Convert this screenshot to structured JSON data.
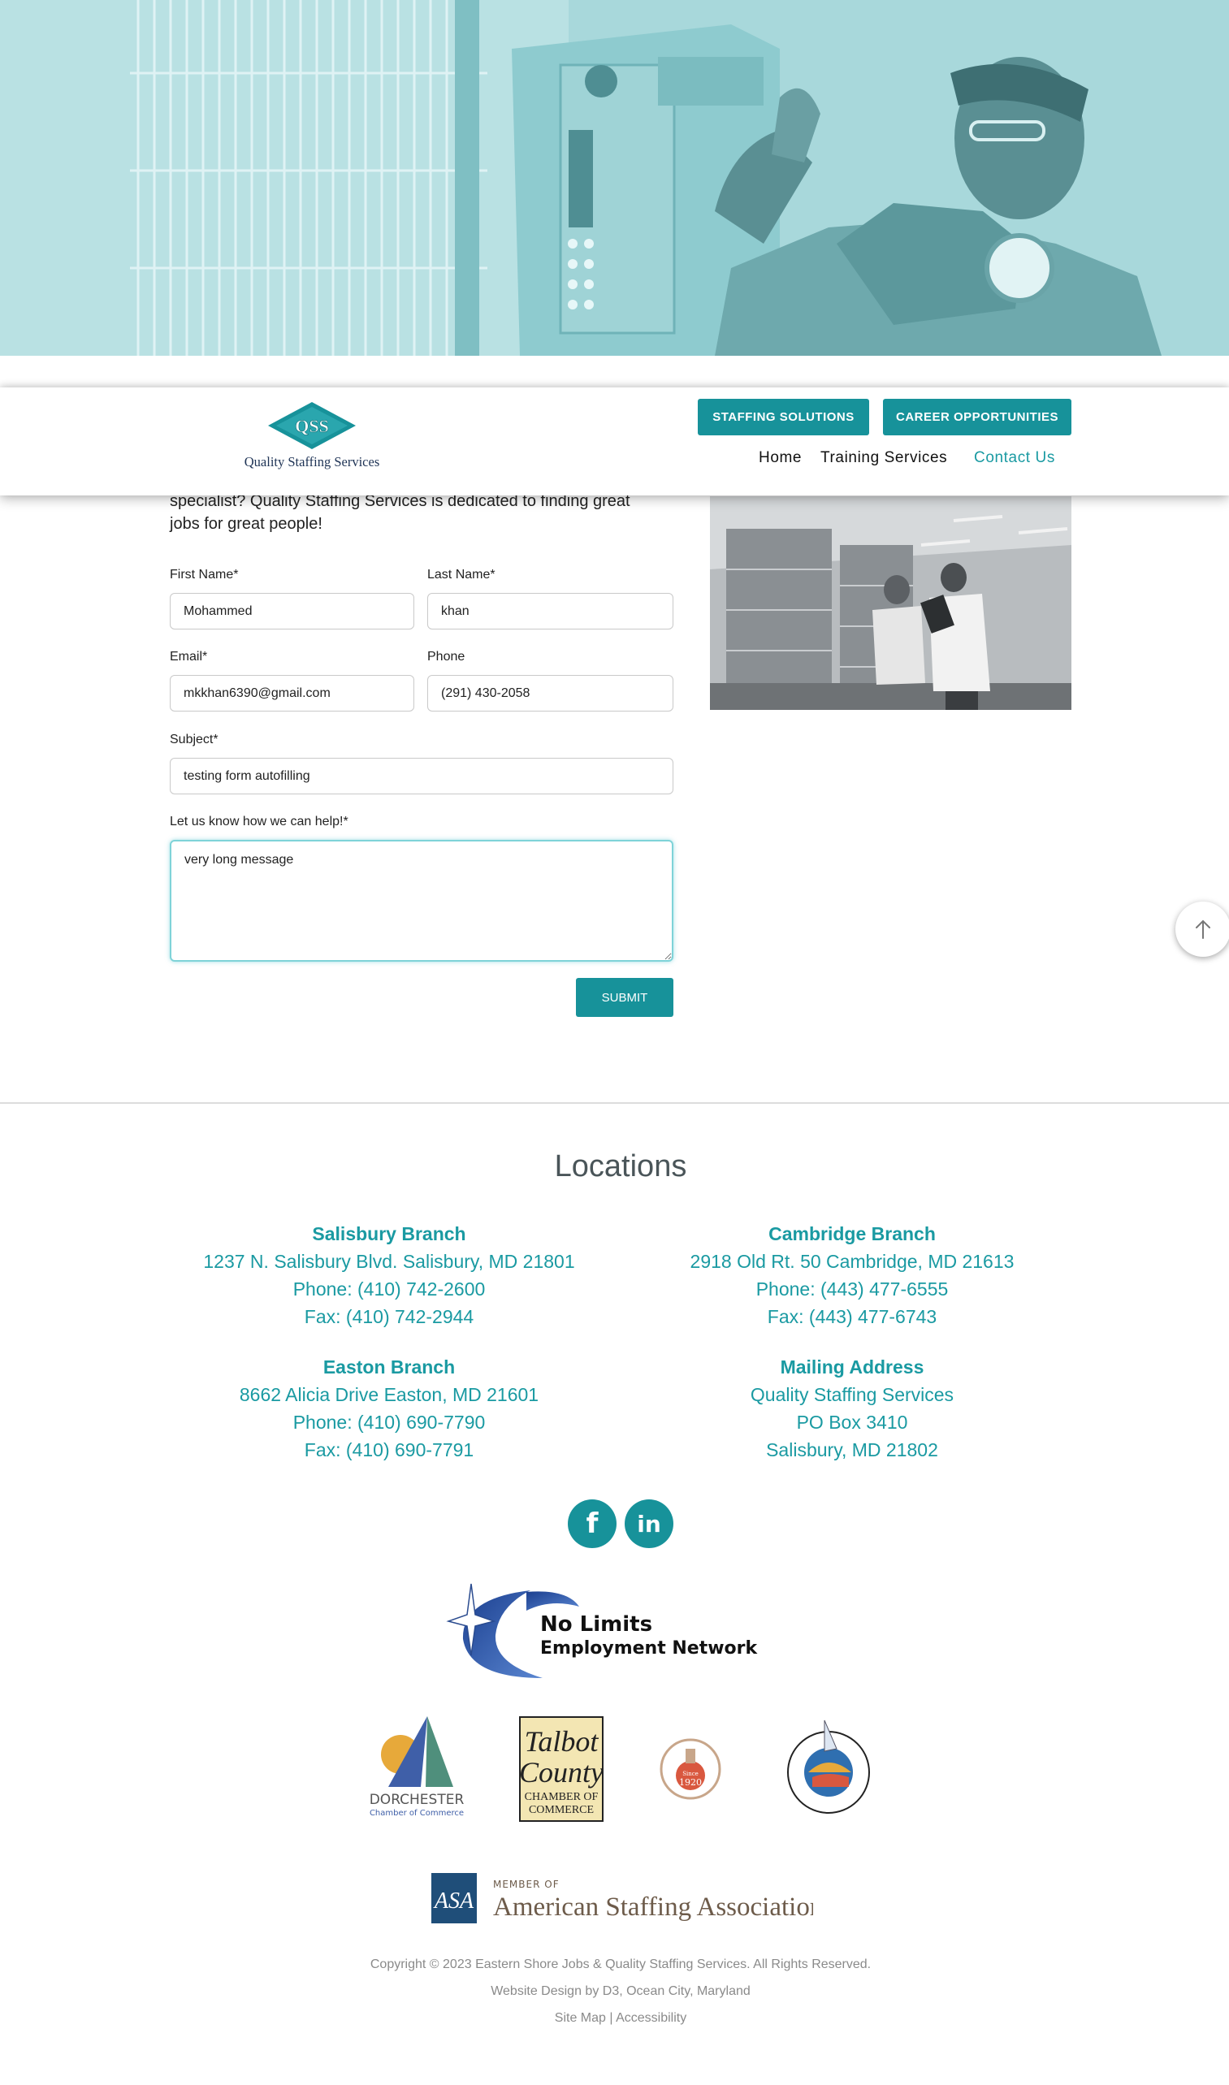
{
  "header": {
    "logo_text": "Quality Staffing Services",
    "logo_mark": "QSS",
    "buttons": {
      "staffing": "STAFFING SOLUTIONS",
      "career": "CAREER OPPORTUNITIES"
    },
    "nav": {
      "home": "Home",
      "training": "Training Services",
      "contact": "Contact Us"
    }
  },
  "form": {
    "intro_line1": "specialist? Quality Staffing Services is dedicated to finding great",
    "intro_line2": "jobs for great people!",
    "first_name": {
      "label": "First Name*",
      "value": "Mohammed"
    },
    "last_name": {
      "label": "Last Name*",
      "value": "khan"
    },
    "email": {
      "label": "Email*",
      "value": "mkkhan6390@gmail.com"
    },
    "phone": {
      "label": "Phone",
      "value": "(291) 430-2058"
    },
    "subject": {
      "label": "Subject*",
      "value": "testing form autofilling"
    },
    "message": {
      "label": "Let us know how we can help!*",
      "value": "very long message"
    },
    "submit_label": "SUBMIT"
  },
  "locations": {
    "title": "Locations",
    "branches": [
      {
        "name": "Salisbury Branch",
        "address": "1237 N. Salisbury Blvd. Salisbury, MD 21801",
        "phone": "Phone: (410) 742-2600",
        "fax": "Fax: (410) 742-2944"
      },
      {
        "name": "Cambridge Branch",
        "address": "2918 Old Rt. 50 Cambridge, MD 21613",
        "phone": "Phone: (443) 477-6555",
        "fax": "Fax: (443) 477-6743"
      },
      {
        "name": "Easton Branch",
        "address": "8662 Alicia Drive Easton, MD 21601",
        "phone": "Phone: (410) 690-7790",
        "fax": "Fax: (410) 690-7791"
      },
      {
        "name": "Mailing Address",
        "address": "Quality Staffing Services",
        "phone": "PO Box 3410",
        "fax": "Salisbury, MD 21802"
      }
    ]
  },
  "social": {
    "facebook": "f",
    "linkedin": "in"
  },
  "partners": {
    "nolimits_line1": "No Limits",
    "nolimits_line2": "Employment Network",
    "dorchester_line1": "DORCHESTER",
    "dorchester_line2": "Chamber of Commerce",
    "talbot_line1": "Talbot",
    "talbot_line2": "County",
    "talbot_line3": "CHAMBER OF",
    "talbot_line4": "COMMERCE",
    "salisbury_since": "Since",
    "salisbury_year": "1920",
    "asa_mark": "ASA",
    "asa_member": "MEMBER OF",
    "asa_name": "American Staffing Association"
  },
  "footer": {
    "copyright": "Copyright © 2023 Eastern Shore Jobs & Quality Staffing Services. All Rights Reserved.",
    "design": "Website Design by D3, Ocean City, Maryland",
    "links": "Site Map | Accessibility"
  },
  "colors": {
    "accent": "#17929a",
    "hero_tint": "#a9d9dc"
  },
  "icons": {
    "scroll_top": "arrow-up-icon",
    "facebook": "facebook-icon",
    "linkedin": "linkedin-icon"
  }
}
